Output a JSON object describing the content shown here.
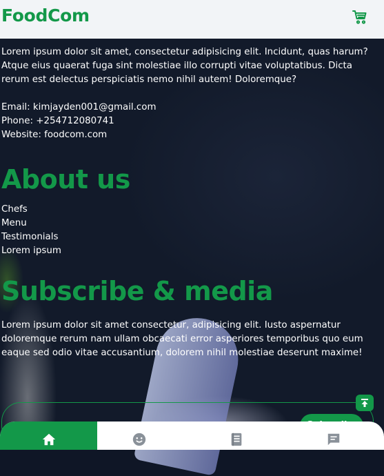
{
  "header": {
    "brand": "FoodCom",
    "cart_icon": "cart-icon"
  },
  "intro": {
    "text": "Lorem ipsum dolor sit amet, consectetur adipisicing elit. Incidunt, quas harum? Atque eius quaerat fuga sint molestiae illo corrupti vitae voluptatibus. Dicta rerum est delectus perspiciatis nemo nihil autem! Doloremque?"
  },
  "contact": {
    "email": "Email: kimjayden001@gmail.com",
    "phone": "Phone: +254712080741",
    "website": "Website: foodcom.com"
  },
  "about": {
    "title": "About us",
    "links": [
      "Chefs",
      "Menu",
      "Testimonials",
      "Lorem ipsum"
    ]
  },
  "subscribe": {
    "title": "Subscribe & media",
    "text": "Lorem ipsum dolor sit amet consectetur, adipisicing elit. Iusto aspernatur doloremque rerum nam ullam obcaecati error asperiores temporibus quo eum eaque sed odio vitae accusantium, dolorem nihil molestiae deserunt maxime!",
    "button_label": "Subscribe"
  },
  "bottom_nav": {
    "items": [
      {
        "icon": "home-icon",
        "active": true
      },
      {
        "icon": "smiley-icon",
        "active": false
      },
      {
        "icon": "book-icon",
        "active": false
      },
      {
        "icon": "chat-icon",
        "active": false
      }
    ]
  },
  "colors": {
    "brand_green": "#139849",
    "header_bg": "#f2f4f7",
    "nav_bg": "#ffffff"
  }
}
